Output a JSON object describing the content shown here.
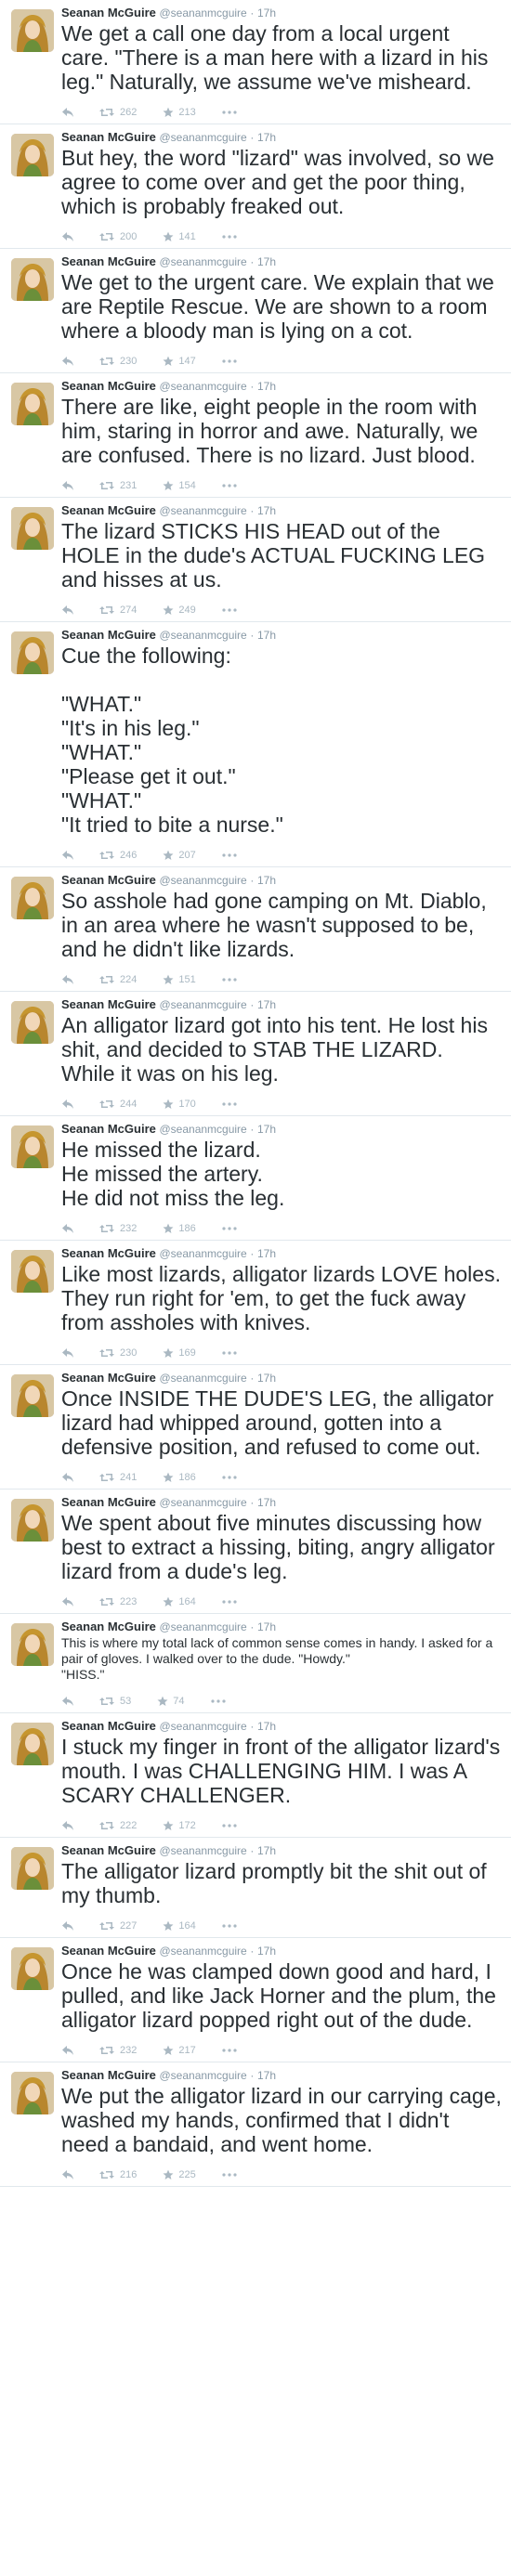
{
  "tweets": [
    {
      "name": "Seanan McGuire",
      "handle": "@seananmcguire",
      "time": "17h",
      "lines": [
        "We get a call one day from a local urgent care. \"There is a man here with a lizard in his leg.\" Naturally, we assume we've misheard."
      ],
      "retweets": "262",
      "favorites": "213",
      "size": "large"
    },
    {
      "name": "Seanan McGuire",
      "handle": "@seananmcguire",
      "time": "17h",
      "lines": [
        "But hey, the word \"lizard\" was involved, so we agree to come over and get the poor thing, which is probably freaked out."
      ],
      "retweets": "200",
      "favorites": "141",
      "size": "large"
    },
    {
      "name": "Seanan McGuire",
      "handle": "@seananmcguire",
      "time": "17h",
      "lines": [
        "We get to the urgent care. We explain that we are Reptile Rescue. We are shown to a room where a bloody man is lying on a cot."
      ],
      "retweets": "230",
      "favorites": "147",
      "size": "large"
    },
    {
      "name": "Seanan McGuire",
      "handle": "@seananmcguire",
      "time": "17h",
      "lines": [
        "There are like, eight people in the room with him, staring in horror and awe. Naturally, we are confused. There is no lizard. Just blood."
      ],
      "retweets": "231",
      "favorites": "154",
      "size": "large"
    },
    {
      "name": "Seanan McGuire",
      "handle": "@seananmcguire",
      "time": "17h",
      "lines": [
        "The lizard STICKS HIS HEAD out of the HOLE in the dude's ACTUAL FUCKING LEG and hisses at us."
      ],
      "retweets": "274",
      "favorites": "249",
      "size": "large"
    },
    {
      "name": "Seanan McGuire",
      "handle": "@seananmcguire",
      "time": "17h",
      "lines": [
        "Cue the following:",
        "",
        "\"WHAT.\"",
        "\"It's in his leg.\"",
        "\"WHAT.\"",
        "\"Please get it out.\"",
        "\"WHAT.\"",
        "\"It tried to bite a nurse.\""
      ],
      "retweets": "246",
      "favorites": "207",
      "size": "large"
    },
    {
      "name": "Seanan McGuire",
      "handle": "@seananmcguire",
      "time": "17h",
      "lines": [
        "So asshole had gone camping on Mt. Diablo, in an area where he wasn't supposed to be, and he didn't like lizards."
      ],
      "retweets": "224",
      "favorites": "151",
      "size": "large"
    },
    {
      "name": "Seanan McGuire",
      "handle": "@seananmcguire",
      "time": "17h",
      "lines": [
        "An alligator lizard got into his tent. He lost his shit, and decided to STAB THE LIZARD. While it was on his leg."
      ],
      "retweets": "244",
      "favorites": "170",
      "size": "large"
    },
    {
      "name": "Seanan McGuire",
      "handle": "@seananmcguire",
      "time": "17h",
      "lines": [
        "He missed the lizard.",
        "He missed the artery.",
        "He did not miss the leg."
      ],
      "retweets": "232",
      "favorites": "186",
      "size": "large"
    },
    {
      "name": "Seanan McGuire",
      "handle": "@seananmcguire",
      "time": "17h",
      "lines": [
        "Like most lizards, alligator lizards LOVE holes. They run right for 'em, to get the fuck away from assholes with knives."
      ],
      "retweets": "230",
      "favorites": "169",
      "size": "large"
    },
    {
      "name": "Seanan McGuire",
      "handle": "@seananmcguire",
      "time": "17h",
      "lines": [
        "Once INSIDE THE DUDE'S LEG, the alligator lizard had whipped around, gotten into a defensive position, and refused to come out."
      ],
      "retweets": "241",
      "favorites": "186",
      "size": "large"
    },
    {
      "name": "Seanan McGuire",
      "handle": "@seananmcguire",
      "time": "17h",
      "lines": [
        "We spent about five minutes discussing how best to extract a hissing, biting, angry alligator lizard from a dude's leg."
      ],
      "retweets": "223",
      "favorites": "164",
      "size": "large"
    },
    {
      "name": "Seanan McGuire",
      "handle": "@seananmcguire",
      "time": "17h",
      "lines": [
        "This is where my total lack of common sense comes in handy. I asked for a pair of gloves. I walked over to the dude. \"Howdy.\"",
        "\"HISS.\""
      ],
      "retweets": "53",
      "favorites": "74",
      "size": "small"
    },
    {
      "name": "Seanan McGuire",
      "handle": "@seananmcguire",
      "time": "17h",
      "lines": [
        "I stuck my finger in front of the alligator lizard's mouth. I was CHALLENGING HIM. I was A SCARY CHALLENGER."
      ],
      "retweets": "222",
      "favorites": "172",
      "size": "large"
    },
    {
      "name": "Seanan McGuire",
      "handle": "@seananmcguire",
      "time": "17h",
      "lines": [
        "The alligator lizard promptly bit the shit out of my thumb."
      ],
      "retweets": "227",
      "favorites": "164",
      "size": "large"
    },
    {
      "name": "Seanan McGuire",
      "handle": "@seananmcguire",
      "time": "17h",
      "lines": [
        "Once he was clamped down good and hard, I pulled, and like Jack Horner and the plum, the alligator lizard popped right out of the dude."
      ],
      "retweets": "232",
      "favorites": "217",
      "size": "large"
    },
    {
      "name": "Seanan McGuire",
      "handle": "@seananmcguire",
      "time": "17h",
      "lines": [
        "We put the alligator lizard in our carrying cage, washed my hands, confirmed that I didn't need a bandaid, and went home."
      ],
      "retweets": "216",
      "favorites": "225",
      "size": "large"
    }
  ],
  "separator": "·",
  "icons": {
    "reply": "reply-icon",
    "retweet": "retweet-icon",
    "favorite": "star-icon",
    "more": "more-icon",
    "avatar": "avatar"
  },
  "colors": {
    "text": "#292f33",
    "muted": "#8899a6",
    "action": "#aab8c2",
    "border": "#e1e8ed"
  }
}
